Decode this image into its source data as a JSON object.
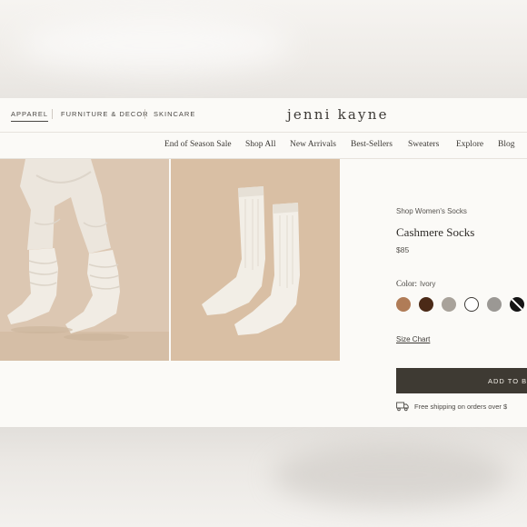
{
  "header": {
    "categories": [
      "APPAREL",
      "FURNITURE & DECOR",
      "SKINCARE"
    ],
    "logo": "jenni kayne"
  },
  "nav": {
    "items": [
      "End of Season Sale",
      "Shop All",
      "New Arrivals",
      "Best-Sellers",
      "Sweaters",
      "Explore",
      "Blog"
    ]
  },
  "product": {
    "breadcrumb": "Shop Women's Socks",
    "title": "Cashmere Socks",
    "price": "$85",
    "color_label": "Color:",
    "color_value": "Ivory",
    "swatches": [
      {
        "name": "camel",
        "color": "#b07c57"
      },
      {
        "name": "chocolate",
        "color": "#4b2a17"
      },
      {
        "name": "oatmeal",
        "color": "#a8a29a"
      },
      {
        "name": "ivory",
        "color": "#ffffff",
        "selected": true
      },
      {
        "name": "grey",
        "color": "#9b9894"
      },
      {
        "name": "black",
        "color": "#141414"
      }
    ],
    "size_chart": "Size Chart",
    "add_to_bag": "ADD TO BAG",
    "shipping": "Free shipping on orders over $"
  },
  "icons": {
    "truck": "truck-icon"
  },
  "colors": {
    "page_bg": "#fbfaf7",
    "button_bg": "#3e3a33",
    "photo_bg": "#d8bea3"
  }
}
